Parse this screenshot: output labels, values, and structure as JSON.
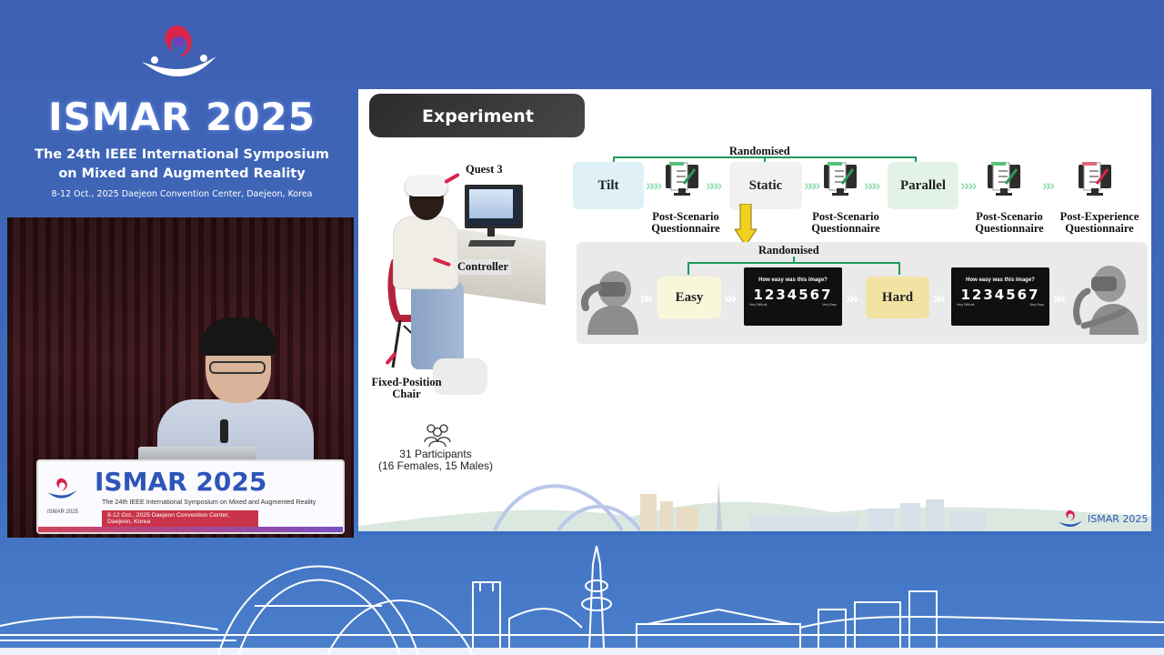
{
  "conference": {
    "title": "ISMAR 2025",
    "subtitle_line1": "The 24th IEEE International Symposium",
    "subtitle_line2": "on Mixed and Augmented Reality",
    "date_venue": "8-12 Oct., 2025 Daejeon Convention Center, Daejeon, Korea"
  },
  "podium": {
    "title": "ISMAR 2025",
    "year": "ISMAR 2025",
    "subtitle": "The 24th IEEE International Symposium on Mixed and Augmented Reality",
    "date_venue": "8-12 Oct., 2025 Daejeon Convention Center, Daejeon, Korea"
  },
  "slide": {
    "header": "Experiment",
    "setup_labels": {
      "quest": "Quest 3",
      "controller": "Controller",
      "chair_line1": "Fixed-Position",
      "chair_line2": "Chair"
    },
    "participants": {
      "count": "31 Participants",
      "breakdown": "(16 Females, 15 Males)"
    },
    "flow": {
      "randomised_top": "Randomised",
      "conditions": [
        "Tilt",
        "Static",
        "Parallel"
      ],
      "post_scenario_line1": "Post-Scenario",
      "post_scenario_line2": "Questionnaire",
      "post_experience_line1": "Post-Experience",
      "post_experience_line2": "Questionnaire",
      "randomised_low": "Randomised",
      "difficulties": [
        "Easy",
        "Hard"
      ],
      "rating_question": "How easy was this image?",
      "rating_scale": "1234567",
      "rating_low": "Very Difficult",
      "rating_high": "Very Easy"
    },
    "footer_logo_text": "ISMAR 2025"
  },
  "colors": {
    "background": "#3f5fb2",
    "accent_red": "#d8244a",
    "bracket_green": "#1e9a5a",
    "brand_blue": "#2e55b8"
  }
}
